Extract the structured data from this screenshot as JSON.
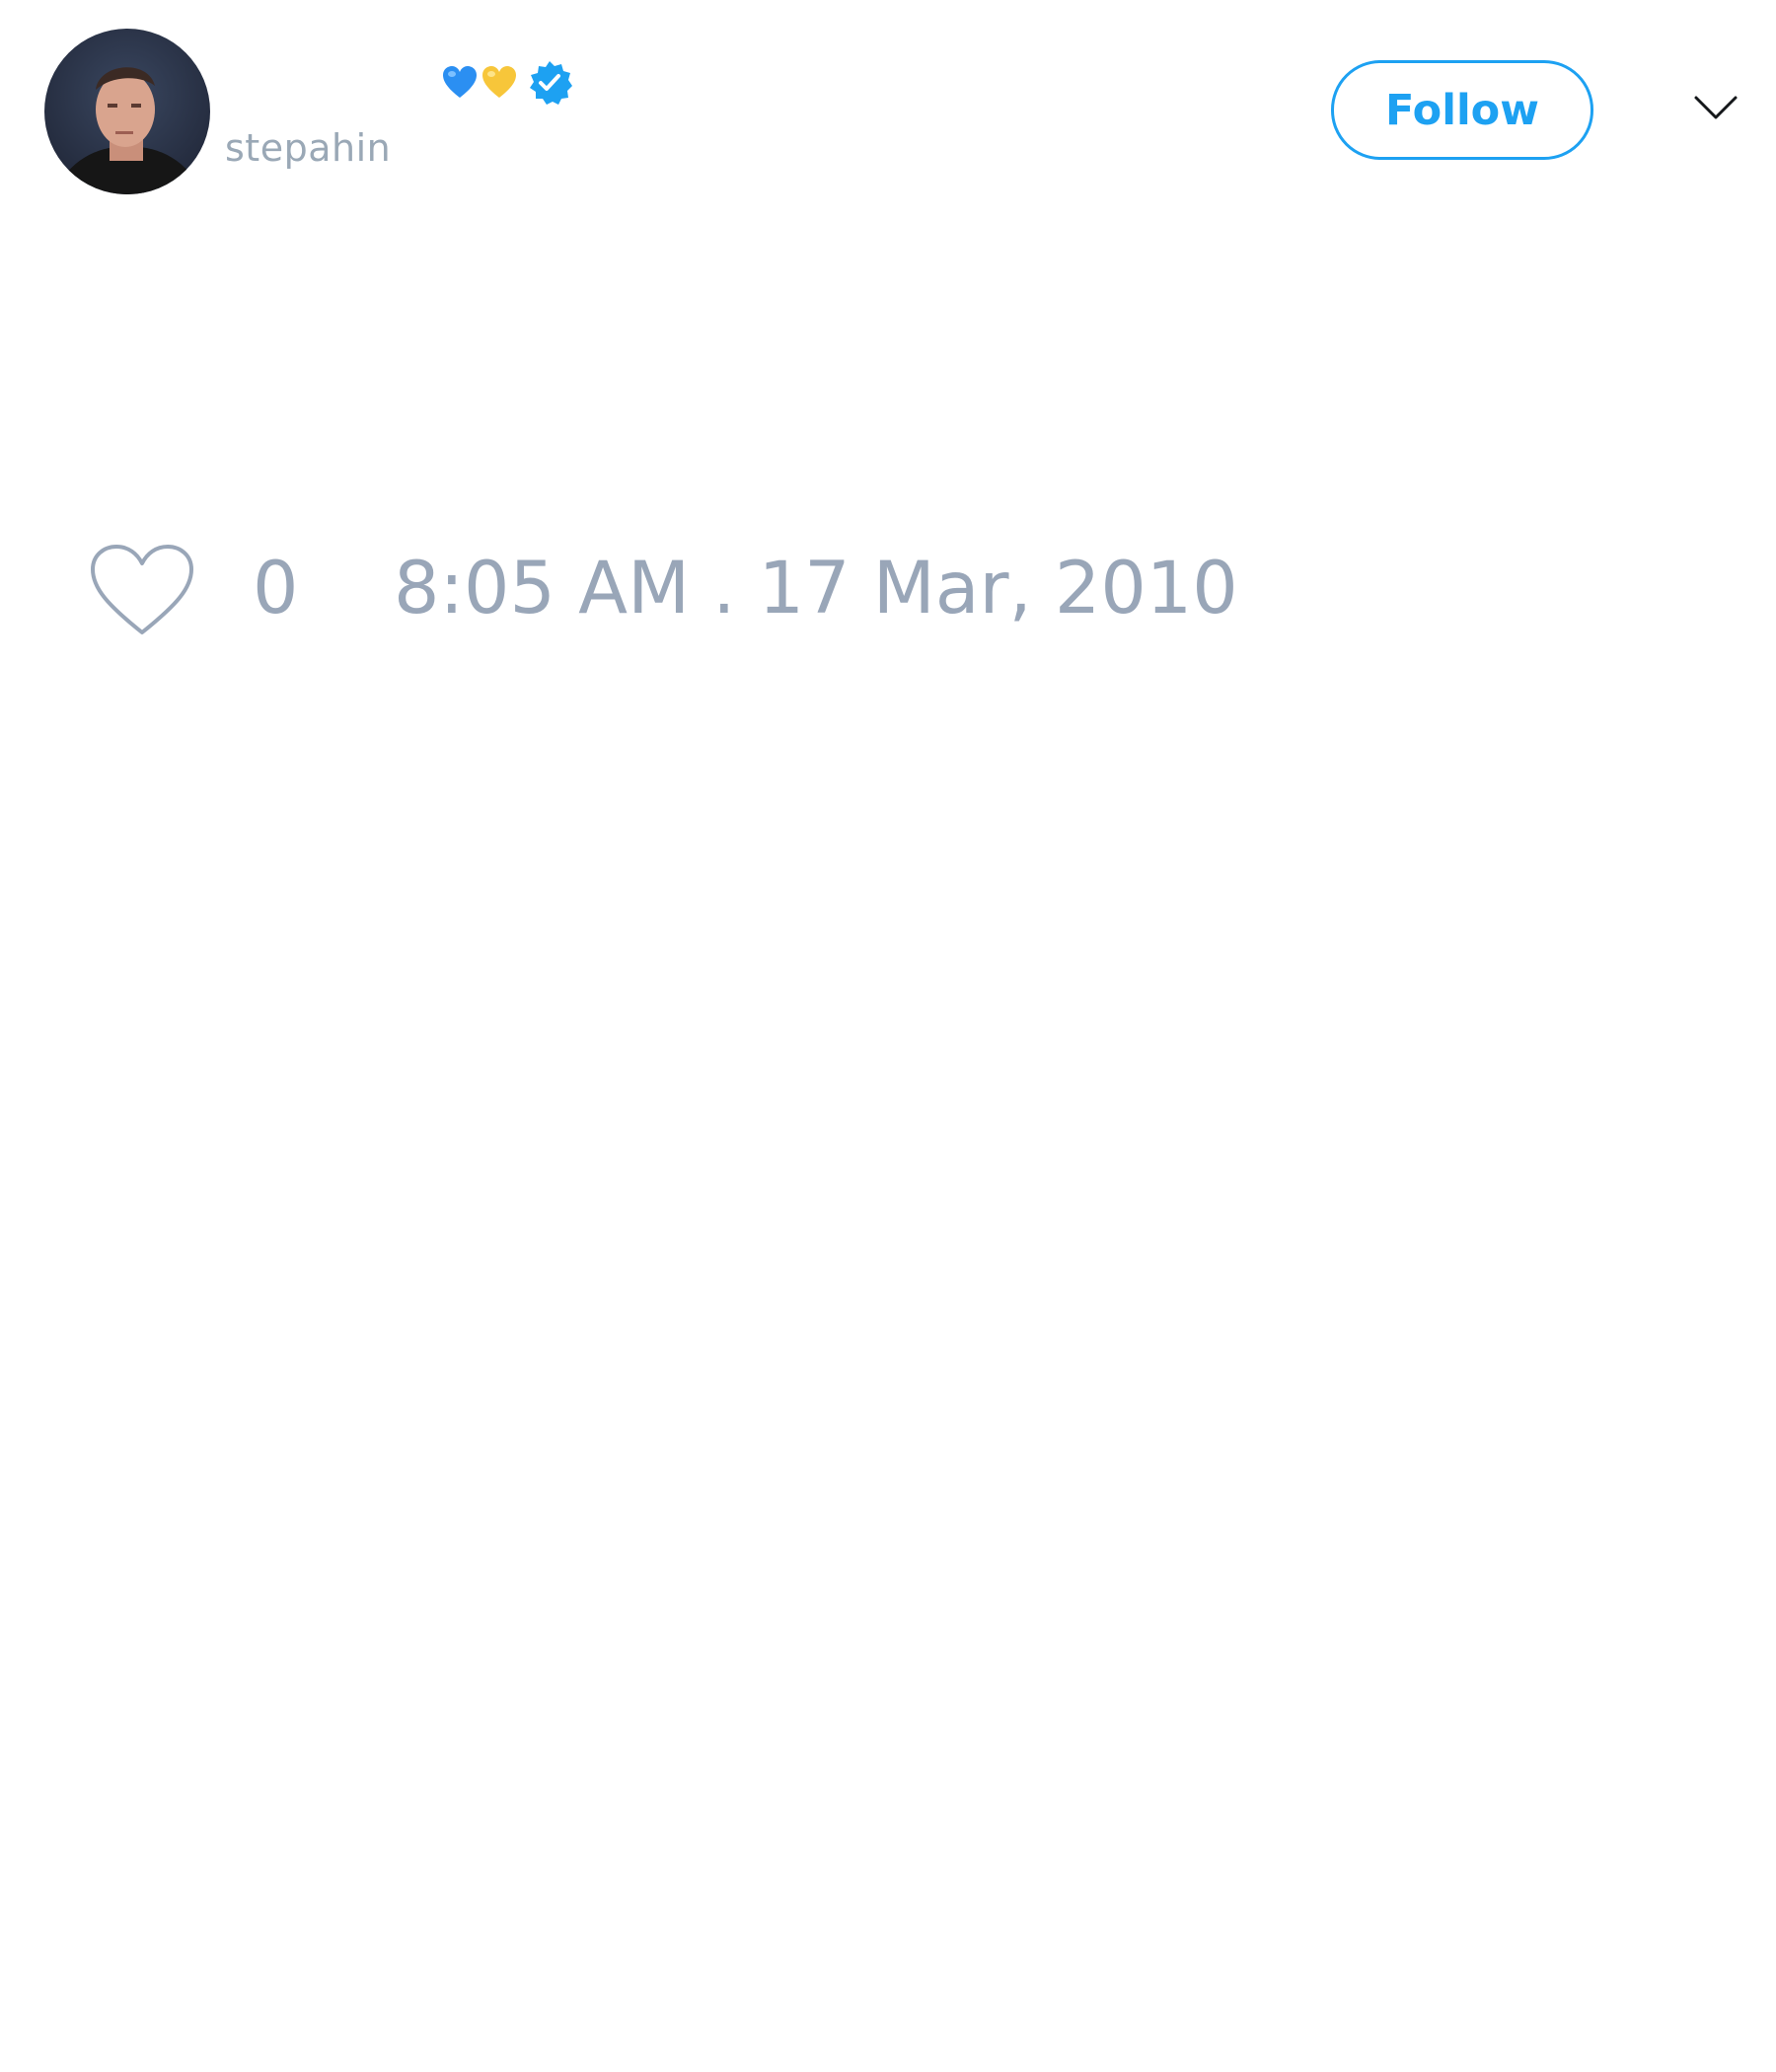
{
  "tweet": {
    "author": {
      "display_name": "",
      "handle": "stepahin",
      "name_emojis": [
        "blue-heart-icon",
        "yellow-heart-icon"
      ],
      "verified": true,
      "avatar": "avatar-photo"
    },
    "follow_label": "Follow",
    "menu_icon": "chevron-down-icon",
    "likes": {
      "icon": "heart-icon",
      "count": "0"
    },
    "timestamp": "8:05 AM . 17 Mar, 2010"
  },
  "colors": {
    "accent": "#1da1f2",
    "muted_text": "#99a6b8",
    "background": "#ffffff",
    "blue_heart": "#2b8ff2",
    "yellow_heart": "#f7c63a"
  }
}
